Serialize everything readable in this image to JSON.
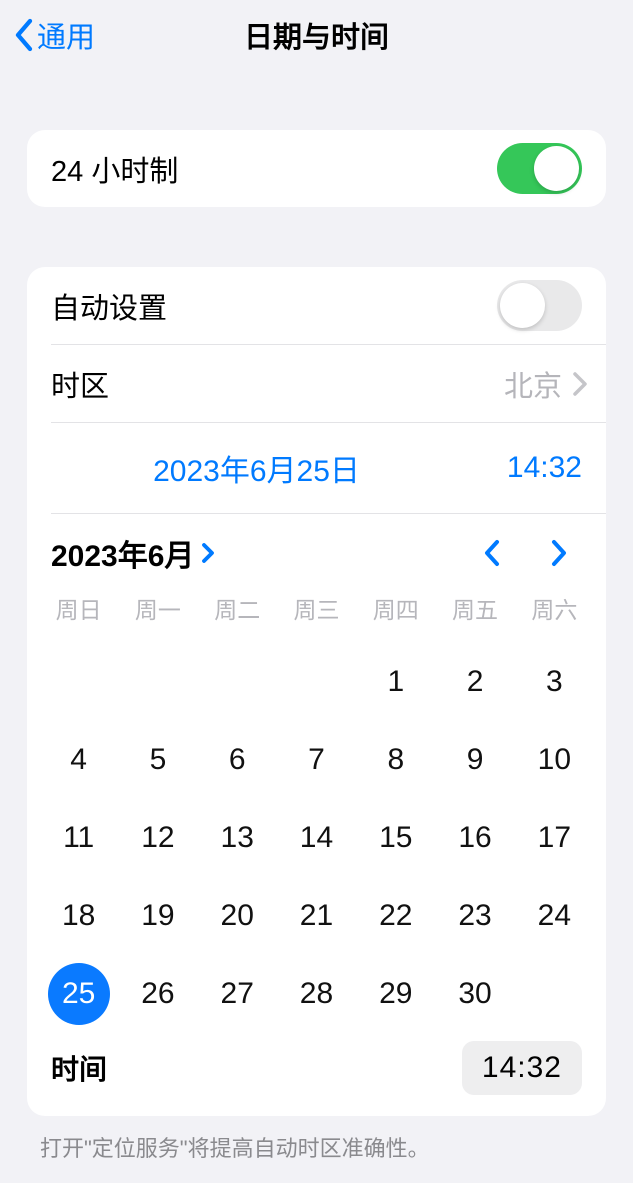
{
  "nav": {
    "back_label": "通用",
    "title": "日期与时间"
  },
  "group1": {
    "h24_label": "24 小时制",
    "h24_on": true
  },
  "group2": {
    "autoset_label": "自动设置",
    "autoset_on": false,
    "timezone_label": "时区",
    "timezone_value": "北京",
    "selected_date_display": "2023年6月25日",
    "selected_time_display": "14:32"
  },
  "calendar": {
    "month_label": "2023年6月",
    "weekdays": [
      "周日",
      "周一",
      "周二",
      "周三",
      "周四",
      "周五",
      "周六"
    ],
    "blanks_before": 4,
    "days_in_month": 30,
    "selected_day": 25,
    "time_label": "时间",
    "time_value": "14:32"
  },
  "footer_note": "打开\"定位服务\"将提高自动时区准确性。"
}
